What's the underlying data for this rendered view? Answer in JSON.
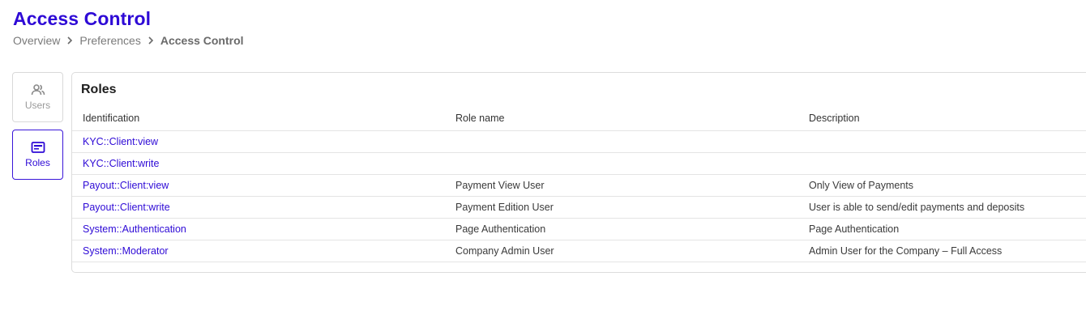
{
  "page": {
    "title": "Access Control"
  },
  "breadcrumb": {
    "items": [
      "Overview",
      "Preferences",
      "Access Control"
    ]
  },
  "side_nav": {
    "items": [
      {
        "label": "Users",
        "icon": "users-icon",
        "active": false
      },
      {
        "label": "Roles",
        "icon": "id-card-icon",
        "active": true
      }
    ]
  },
  "roles_card": {
    "title": "Roles",
    "columns": [
      "Identification",
      "Role name",
      "Description"
    ],
    "rows": [
      {
        "id": "KYC::Client:view",
        "role_name": "",
        "description": ""
      },
      {
        "id": "KYC::Client:write",
        "role_name": "",
        "description": ""
      },
      {
        "id": "Payout::Client:view",
        "role_name": "Payment View User",
        "description": "Only View of Payments"
      },
      {
        "id": "Payout::Client:write",
        "role_name": "Payment Edition User",
        "description": "User is able to send/edit payments and deposits"
      },
      {
        "id": "System::Authentication",
        "role_name": "Page Authentication",
        "description": "Page Authentication"
      },
      {
        "id": "System::Moderator",
        "role_name": "Company Admin User",
        "description": "Admin User for the Company – Full Access"
      }
    ]
  },
  "colors": {
    "accent": "#2e0ad6",
    "border": "#dcdcdc",
    "muted_text": "#7a7a7a"
  }
}
